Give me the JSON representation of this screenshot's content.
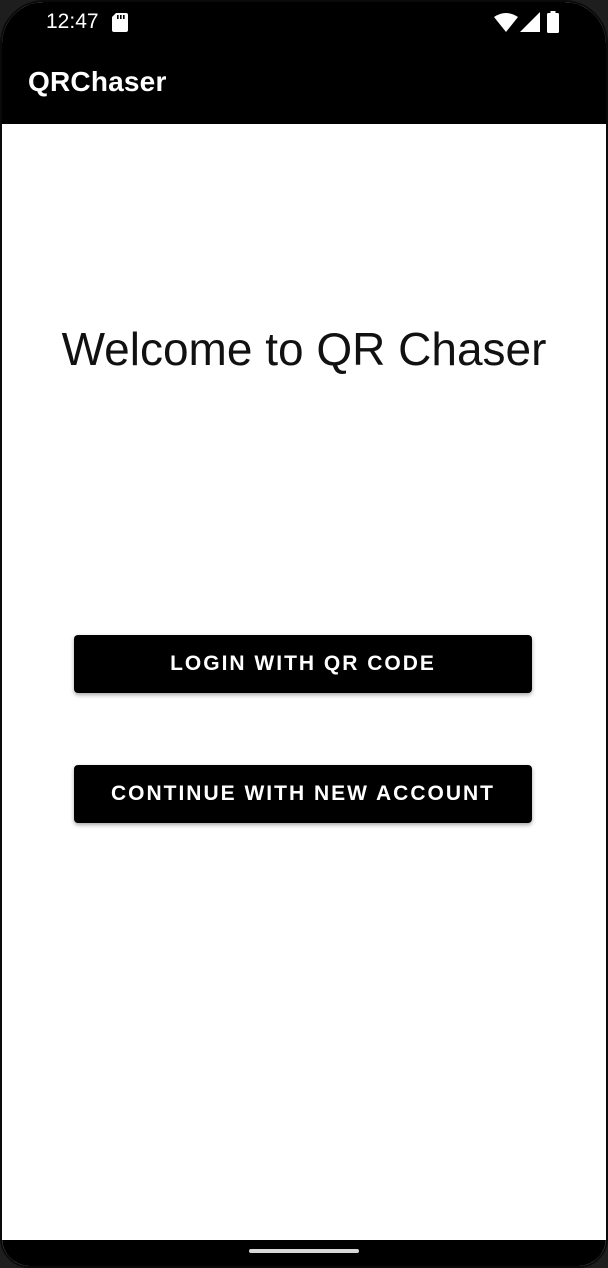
{
  "status_bar": {
    "time": "12:47",
    "icons": [
      "sd-card-icon",
      "wifi-icon",
      "cell-signal-icon",
      "battery-icon"
    ]
  },
  "app_bar": {
    "title": "QRChaser"
  },
  "main": {
    "welcome_text": "Welcome to QR Chaser",
    "login_button_label": "LOGIN WITH QR CODE",
    "continue_button_label": "CONTINUE WITH NEW ACCOUNT"
  },
  "colors": {
    "app_bar_background": "#000000",
    "button_background": "#000000",
    "button_text": "#ffffff",
    "page_background": "#ffffff"
  }
}
